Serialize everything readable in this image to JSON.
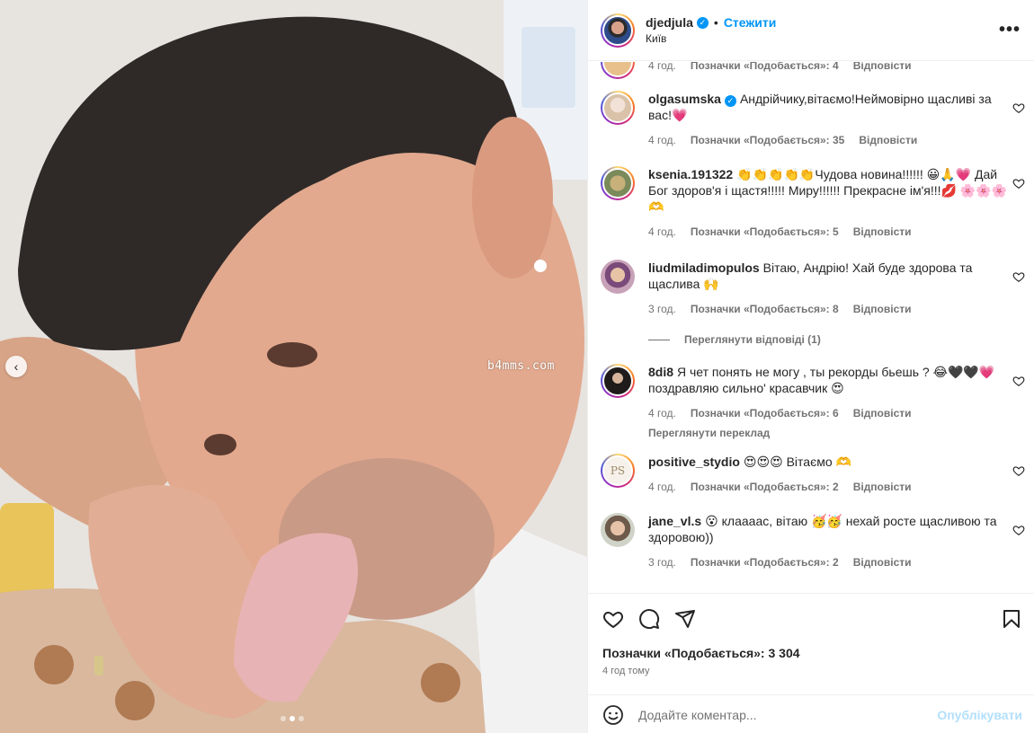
{
  "post": {
    "author": "djedjula",
    "follow_label": "Стежити",
    "separator": "•",
    "location": "Київ",
    "more_glyph": "•••",
    "watermark": "b4mms.com",
    "carousel_prev_glyph": "‹"
  },
  "top_meta": {
    "time": "4 год.",
    "likes": "Позначки «Подобається»: 4",
    "reply": "Відповісти"
  },
  "comments": [
    {
      "user": "olgasumska",
      "verified": true,
      "text": "Андрійчику,вітаємо!Неймовірно щасливі за вас!💗",
      "time": "4 год.",
      "likes": "Позначки «Подобається»: 35",
      "reply": "Відповісти"
    },
    {
      "user": "ksenia.191322",
      "verified": false,
      "text": "👏👏👏👏👏Чудова новина!!!!!! 😀🙏💗 Дай Бог здоров'я і щастя!!!!! Миру!!!!!! Прекрасне ім'я!!!💋 🌸🌸🌸🫶",
      "time": "4 год.",
      "likes": "Позначки «Подобається»: 5",
      "reply": "Відповісти"
    },
    {
      "user": "liudmiladimopulos",
      "verified": false,
      "text": "Вітаю, Андрію! Хай буде здорова та щаслива 🙌",
      "time": "3 год.",
      "likes": "Позначки «Подобається»: 8",
      "reply": "Відповісти"
    },
    {
      "user": "8di8",
      "verified": false,
      "text": "Я чет понять не могу , ты рекорды бьешь ? 😂🖤🖤💗 поздравляю сильно' красавчик 😍",
      "time": "4 год.",
      "likes": "Позначки «Подобається»: 6",
      "reply": "Відповісти",
      "extra": "Переглянути переклад"
    },
    {
      "user": "positive_stydio",
      "verified": false,
      "text": "😍😍😍 Вітаємо 🫶",
      "time": "4 год.",
      "likes": "Позначки «Подобається»: 2",
      "reply": "Відповісти"
    },
    {
      "user": "jane_vl.s",
      "verified": false,
      "text": "😮 клаааас, вітаю 🥳🥳 нехай росте щасливою та здоровою))",
      "time": "3 год.",
      "likes": "Позначки «Подобається»: 2",
      "reply": "Відповісти"
    }
  ],
  "view_replies": "Переглянути відповіді (1)",
  "footer": {
    "likes_total": "Позначки «Подобається»: 3 304",
    "time_ago": "4 год тому",
    "comment_placeholder": "Додайте коментар...",
    "post_label": "Опублікувати"
  },
  "icons": [
    "heart-icon",
    "comment-icon",
    "share-icon",
    "bookmark-icon",
    "emoji-icon",
    "verified-icon",
    "more-icon"
  ],
  "colors": {
    "link": "#0095f6",
    "muted": "#737373",
    "post_disabled": "#b2dffc",
    "text": "#262626"
  }
}
